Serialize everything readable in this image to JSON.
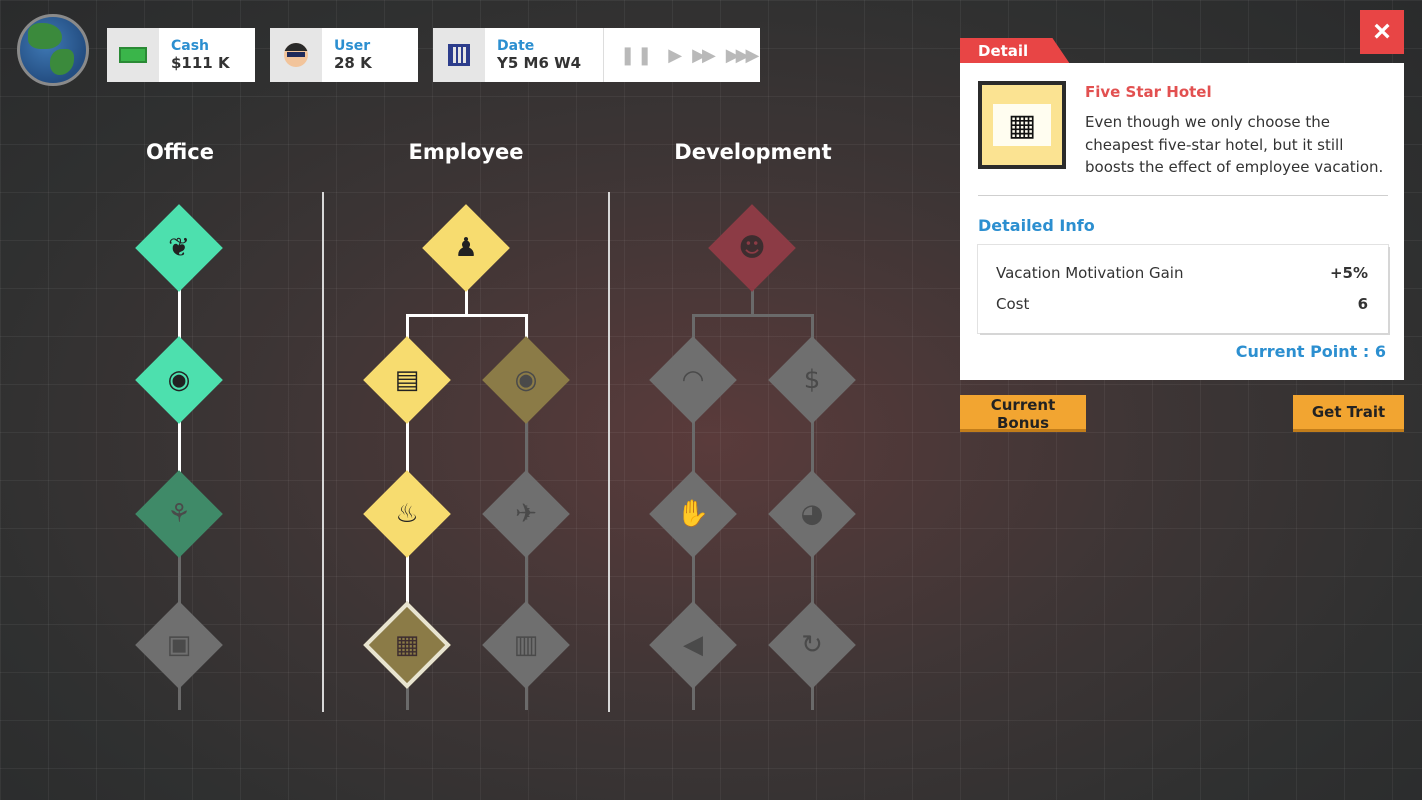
{
  "hud": {
    "cash": {
      "label": "Cash",
      "value": "$111 K",
      "icon": "cash-icon"
    },
    "user": {
      "label": "User",
      "value": "28 K",
      "icon": "user-icon"
    },
    "date": {
      "label": "Date",
      "value": "Y5 M6 W4",
      "icon": "calendar-icon"
    },
    "speed_controls": [
      "pause",
      "play",
      "fast-forward",
      "fastest-forward"
    ]
  },
  "columns": [
    {
      "title": "Office"
    },
    {
      "title": "Employee"
    },
    {
      "title": "Development"
    }
  ],
  "detail": {
    "tab_label": "Detail",
    "close_label": "×",
    "item_title": "Five Star Hotel",
    "item_description": "Even though we only choose the cheapest five-star hotel, but it still boosts the effect of employee vacation.",
    "info_title": "Detailed Info",
    "info_rows": [
      {
        "label": "Vacation Motivation Gain",
        "value": "+5%"
      },
      {
        "label": "Cost",
        "value": "6"
      }
    ],
    "current_point": "Current Point : 6"
  },
  "buttons": {
    "current_bonus": "Current Bonus",
    "get_trait": "Get Trait"
  },
  "colors": {
    "accent_red": "#e84545",
    "accent_blue": "#2c8fd0",
    "button_orange": "#f2a531",
    "office_green": "#4de0ae",
    "employee_yellow": "#f7dc6f",
    "development_red": "#8c3b45"
  }
}
